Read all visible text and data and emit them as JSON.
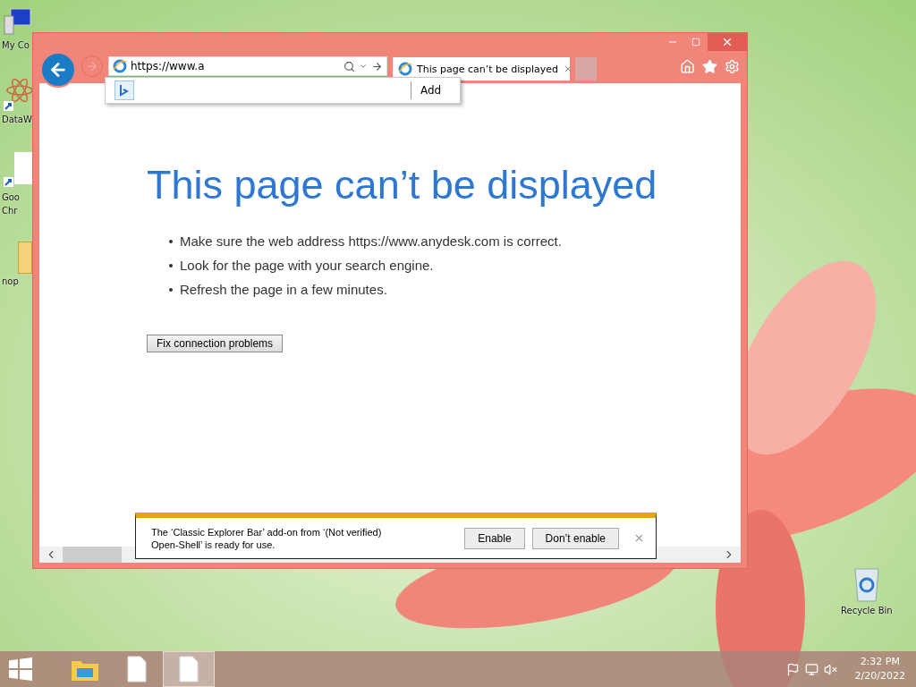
{
  "desktop_icons": [
    {
      "kind": "computer",
      "lines": [
        "My Co"
      ]
    },
    {
      "kind": "app",
      "lines": [
        "DataW"
      ]
    },
    {
      "kind": "document",
      "lines": [
        "Goo",
        "Chr"
      ]
    },
    {
      "kind": "folder",
      "lines": [
        "nop"
      ]
    }
  ],
  "recycle_bin": {
    "label": "Recycle Bin"
  },
  "browser": {
    "address": {
      "value": "https://www.a"
    },
    "suggestion": {
      "action": "Add"
    },
    "tabs": [
      {
        "title": "This page can’t be displayed",
        "selected": true
      }
    ],
    "heading": "This page can’t be displayed",
    "bullets": [
      "Make sure the web address https://www.anydesk.com is correct.",
      "Look for the page with your search engine.",
      "Refresh the page in a few minutes."
    ],
    "fix_button": "Fix connection problems",
    "notification": {
      "message": "The ‘Classic Explorer Bar’ add-on from ‘(Not verified) Open-Shell’ is ready for use.",
      "buttons": [
        "Enable",
        "Don’t enable"
      ]
    }
  },
  "taskbar": {
    "items": [
      {
        "kind": "explorer",
        "selected": false
      },
      {
        "kind": "file",
        "selected": false
      },
      {
        "kind": "file",
        "selected": true
      }
    ],
    "time": "2:32 PM",
    "date": "2/20/2022"
  }
}
